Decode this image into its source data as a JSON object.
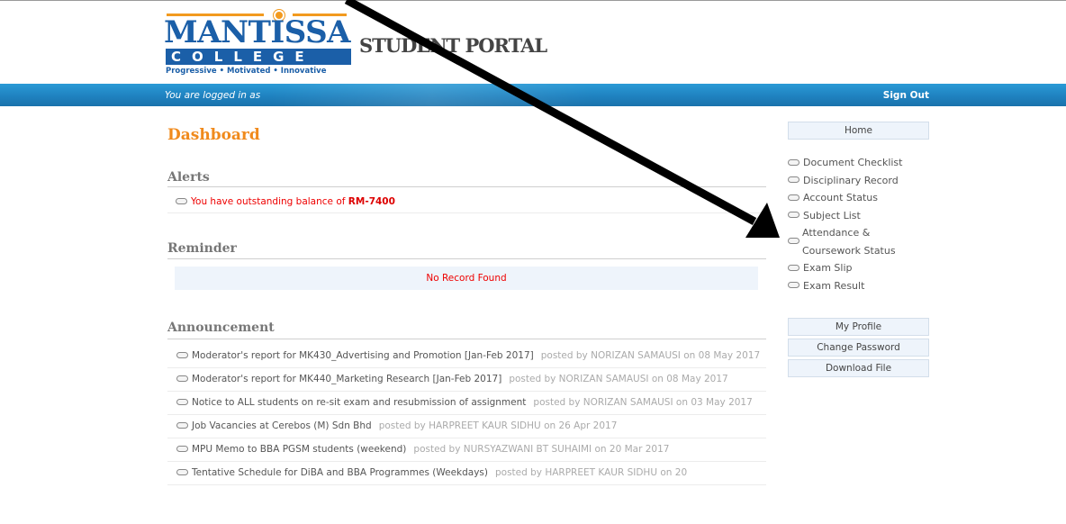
{
  "logo": {
    "name": "MANTISSA",
    "college": "COLLEGE",
    "tagline": "Progressive • Motivated • Innovative"
  },
  "portal_title": "STUDENT PORTAL",
  "navbar": {
    "logged_in_text": "You are logged in as",
    "sign_out_label": "Sign Out"
  },
  "main": {
    "title": "Dashboard",
    "alerts": {
      "heading": "Alerts",
      "text": "You have outstanding balance of ",
      "amount": "RM-7400"
    },
    "reminder": {
      "heading": "Reminder",
      "empty_text": "No Record Found"
    },
    "announcement": {
      "heading": "Announcement",
      "items": [
        {
          "title": "Moderator's report for MK430_Advertising and Promotion [Jan-Feb 2017]",
          "posted": "posted by NORIZAN SAMAUSI on 08 May 2017"
        },
        {
          "title": "Moderator's report for MK440_Marketing Research [Jan-Feb 2017]",
          "posted": "posted by NORIZAN SAMAUSI on 08 May 2017"
        },
        {
          "title": "Notice to ALL students on re-sit exam and resubmission of assignment",
          "posted": "posted by NORIZAN SAMAUSI on 03 May 2017"
        },
        {
          "title": "Job Vacancies at Cerebos (M) Sdn Bhd",
          "posted": "posted by HARPREET KAUR SIDHU on 26 Apr 2017"
        },
        {
          "title": "MPU Memo to BBA PGSM students (weekend)",
          "posted": "posted by NURSYAZWANI BT SUHAIMI on 20 Mar 2017"
        },
        {
          "title": "Tentative Schedule for DiBA and BBA Programmes (Weekdays)",
          "posted": "posted by HARPREET KAUR SIDHU on 20"
        }
      ]
    }
  },
  "sidebar": {
    "home_label": "Home",
    "links": [
      {
        "label": "Document Checklist"
      },
      {
        "label": "Disciplinary Record"
      },
      {
        "label": "Account Status"
      },
      {
        "label": "Subject List"
      },
      {
        "label": "Attendance & Coursework Status"
      },
      {
        "label": "Exam Slip"
      },
      {
        "label": "Exam Result"
      }
    ],
    "my_profile_label": "My Profile",
    "change_password_label": "Change Password",
    "download_file_label": "Download File"
  },
  "colors": {
    "brand_blue": "#1b5fa8",
    "accent_orange": "#f08a1c",
    "navbar_blue": "#1f82c0",
    "alert_red": "#e00000"
  }
}
